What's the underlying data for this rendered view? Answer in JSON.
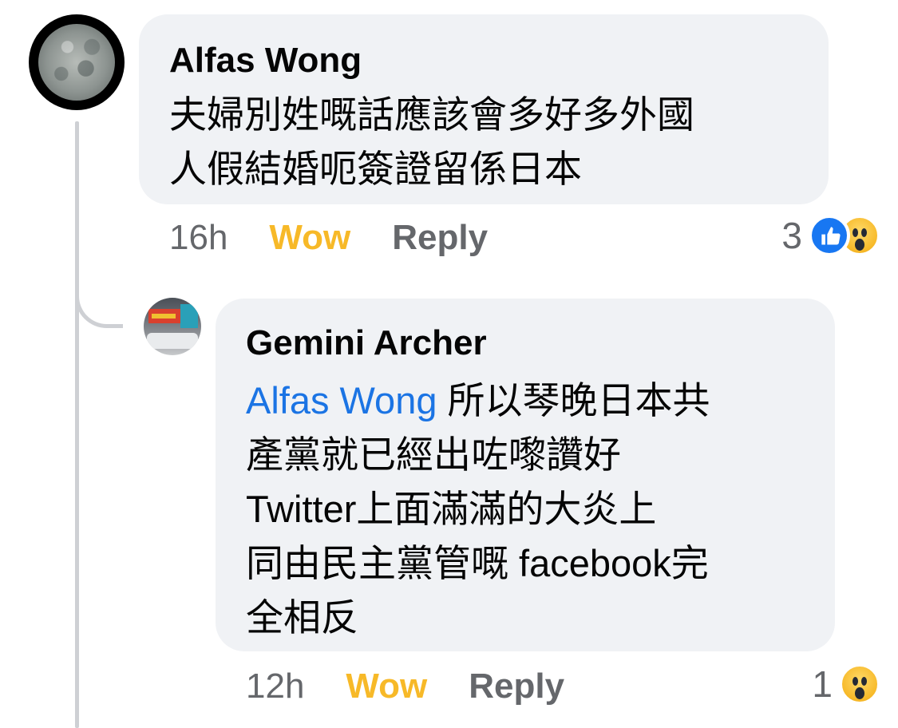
{
  "comments": [
    {
      "author": "Alfas Wong",
      "body_lines": [
        "夫婦別姓嘅話應該會多好多外國",
        "人假結婚呃簽證留係日本"
      ],
      "time": "16h",
      "reaction_label": "Wow",
      "reply_label": "Reply",
      "reaction_count": "3",
      "reaction_icons": [
        "like-icon",
        "wow-icon"
      ]
    },
    {
      "author": "Gemini Archer",
      "mention": "Alfas Wong",
      "body_lines": [
        " 所以琴晚日本共",
        "產黨就已經出咗嚟讚好",
        "Twitter上面滿滿的大炎上",
        "同由民主黨管嘅 facebook完",
        "全相反"
      ],
      "time": "12h",
      "reaction_label": "Wow",
      "reply_label": "Reply",
      "reaction_count": "1",
      "reaction_icons": [
        "wow-icon"
      ]
    }
  ],
  "colors": {
    "bubble": "#f0f2f5",
    "wow": "#f7b928",
    "mention": "#1b74e4",
    "meta": "#65676b",
    "like": "#1877f2"
  }
}
